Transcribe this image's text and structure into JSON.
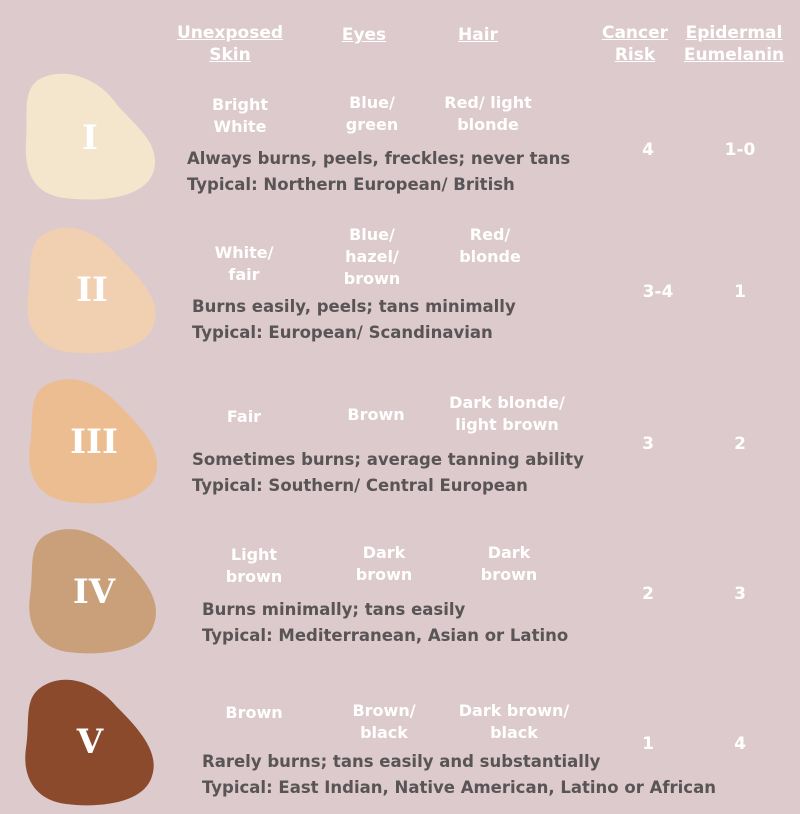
{
  "headers": {
    "skin": "Unexposed\nSkin",
    "eyes": "Eyes",
    "hair": "Hair",
    "cancer": "Cancer\nRisk",
    "eumelanin": "Epidermal\nEumelanin"
  },
  "types": [
    {
      "numeral": "I",
      "color": "#f3e6cd",
      "skin": "Bright\nWhite",
      "eyes": "Blue/\ngreen",
      "hair": "Red/ light\nblonde",
      "reaction": "Always burns, peels, freckles; never tans",
      "typical": "Typical: Northern European/ British",
      "cancer_risk": "4",
      "eumelanin": "1-0"
    },
    {
      "numeral": "II",
      "color": "#f1cfb1",
      "skin": "White/\nfair",
      "eyes": "Blue/\nhazel/\nbrown",
      "hair": "Red/\nblonde",
      "reaction": "Burns easily, peels; tans minimally",
      "typical": "Typical: European/ Scandinavian",
      "cancer_risk": "3-4",
      "eumelanin": "1"
    },
    {
      "numeral": "III",
      "color": "#ecbd90",
      "skin": "Fair",
      "eyes": "Brown",
      "hair": "Dark blonde/\nlight brown",
      "reaction": "Sometimes burns; average tanning ability",
      "typical": "Typical: Southern/ Central European",
      "cancer_risk": "3",
      "eumelanin": "2"
    },
    {
      "numeral": "IV",
      "color": "#c9a07a",
      "skin": "Light\nbrown",
      "eyes": "Dark\nbrown",
      "hair": "Dark\nbrown",
      "reaction": "Burns minimally; tans easily",
      "typical": "Typical: Mediterranean, Asian or Latino",
      "cancer_risk": "2",
      "eumelanin": "3"
    },
    {
      "numeral": "V",
      "color": "#8b4a2c",
      "skin": "Brown",
      "eyes": "Brown/\nblack",
      "hair": "Dark brown/\nblack",
      "reaction": "Rarely burns; tans easily and substantially",
      "typical": "Typical: East Indian, Native American, Latino or African",
      "cancer_risk": "1",
      "eumelanin": "4"
    }
  ]
}
